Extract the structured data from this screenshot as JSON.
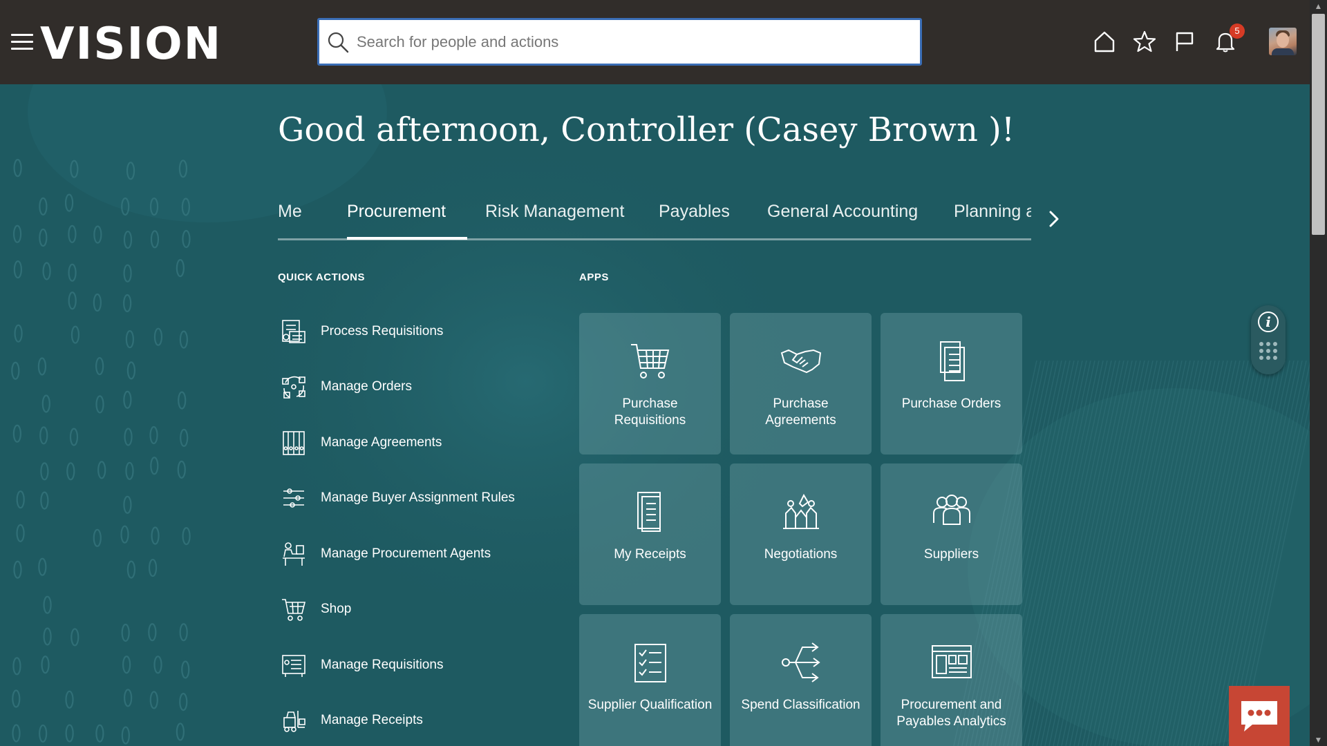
{
  "header": {
    "logo": "VISION",
    "search": {
      "placeholder": "Search for people and actions",
      "value": ""
    },
    "notification_count": "5",
    "icons": [
      "home-icon",
      "favorites-star-icon",
      "watchlist-flag-icon",
      "notifications-bell-icon"
    ]
  },
  "greeting": "Good afternoon, Controller (Casey Brown )!",
  "tabs": [
    {
      "label": "Me",
      "active": false
    },
    {
      "label": "Procurement",
      "active": true
    },
    {
      "label": "Risk Management",
      "active": false
    },
    {
      "label": "Payables",
      "active": false
    },
    {
      "label": "General Accounting",
      "active": false
    },
    {
      "label": "Planning ar",
      "active": false
    }
  ],
  "quick_actions": {
    "heading": "QUICK ACTIONS",
    "items": [
      {
        "label": "Process Requisitions",
        "icon": "requisition-process-icon"
      },
      {
        "label": "Manage Orders",
        "icon": "orders-cycle-icon"
      },
      {
        "label": "Manage Agreements",
        "icon": "binders-icon"
      },
      {
        "label": "Manage Buyer Assignment Rules",
        "icon": "rules-sliders-icon"
      },
      {
        "label": "Manage Procurement Agents",
        "icon": "agent-desk-icon"
      },
      {
        "label": "Shop",
        "icon": "shopping-cart-icon"
      },
      {
        "label": "Manage Requisitions",
        "icon": "requisition-list-icon"
      },
      {
        "label": "Manage Receipts",
        "icon": "forklift-icon"
      }
    ]
  },
  "apps": {
    "heading": "APPS",
    "tiles": [
      {
        "label": "Purchase Requisitions",
        "icon": "shopping-cart-icon"
      },
      {
        "label": "Purchase Agreements",
        "icon": "handshake-icon"
      },
      {
        "label": "Purchase Orders",
        "icon": "documents-icon"
      },
      {
        "label": "My Receipts",
        "icon": "receipt-icon"
      },
      {
        "label": "Negotiations",
        "icon": "negotiation-icon"
      },
      {
        "label": "Suppliers",
        "icon": "people-group-icon"
      },
      {
        "label": "Supplier Qualification",
        "icon": "checklist-icon"
      },
      {
        "label": "Spend Classification",
        "icon": "classification-arrows-icon"
      },
      {
        "label": "Procurement and Payables Analytics",
        "icon": "analytics-dashboard-icon"
      }
    ]
  },
  "colors": {
    "header_bg": "#312d2a",
    "page_bg": "#1f5c63",
    "tile_bg": "rgba(120,170,175,0.35)",
    "badge": "#d63b25",
    "chat_button": "#c74634",
    "search_border": "#3a6db5"
  }
}
